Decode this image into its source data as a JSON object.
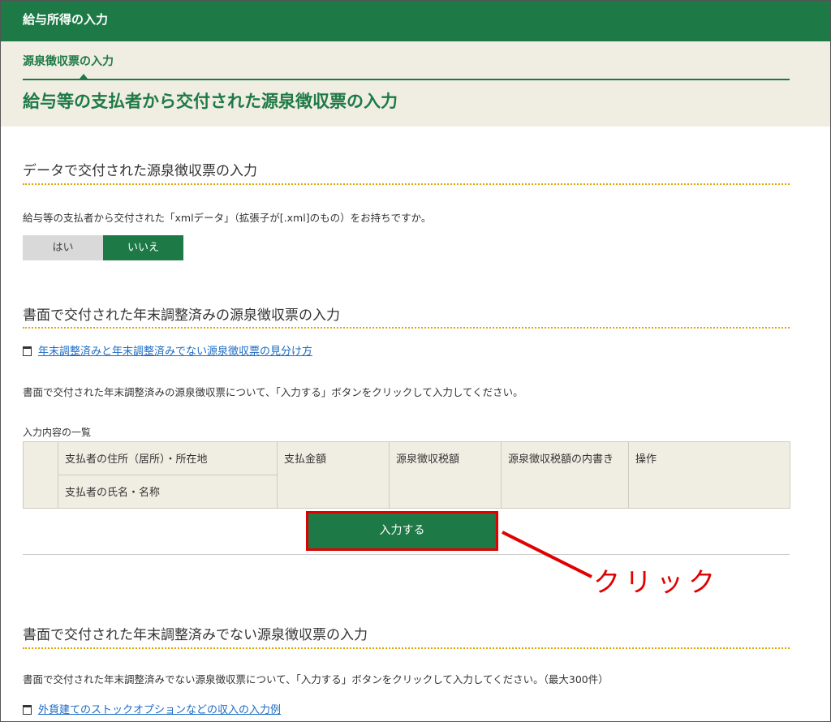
{
  "topbar": {
    "title": "給与所得の入力"
  },
  "header": {
    "breadcrumb": "源泉徴収票の入力",
    "title": "給与等の支払者から交付された源泉徴収票の入力"
  },
  "section1": {
    "title": "データで交付された源泉徴収票の入力",
    "question": "給与等の支払者から交付された「xmlデータ」（拡張子が[.xml]のもの）をお持ちですか。",
    "yes_label": "はい",
    "no_label": "いいえ",
    "selected": "いいえ"
  },
  "section2": {
    "title": "書面で交付された年末調整済みの源泉徴収票の入力",
    "link": "年末調整済みと年末調整済みでない源泉徴収票の見分け方",
    "instruction": "書面で交付された年末調整済みの源泉徴収票について、「入力する」ボタンをクリックして入力してください。",
    "table_caption": "入力内容の一覧",
    "columns": {
      "address": "支払者の住所（居所）・所在地",
      "name": "支払者の氏名・名称",
      "amount": "支払金額",
      "tax": "源泉徴収税額",
      "tax_breakdown": "源泉徴収税額の内書き",
      "action": "操作"
    },
    "button_label": "入力する"
  },
  "annotation": {
    "text": "クリック",
    "color": "#e00000"
  },
  "section3": {
    "title": "書面で交付された年末調整済みでない源泉徴収票の入力",
    "instruction": "書面で交付された年末調整済みでない源泉徴収票について、「入力する」ボタンをクリックして入力してください。（最大300件）",
    "link": "外貨建てのストックオプションなどの収入の入力例"
  },
  "colors": {
    "brand_green": "#1d7a46",
    "band_beige": "#f0ede2",
    "dotted_orange": "#e3a400",
    "link_blue": "#1a6bc4"
  }
}
